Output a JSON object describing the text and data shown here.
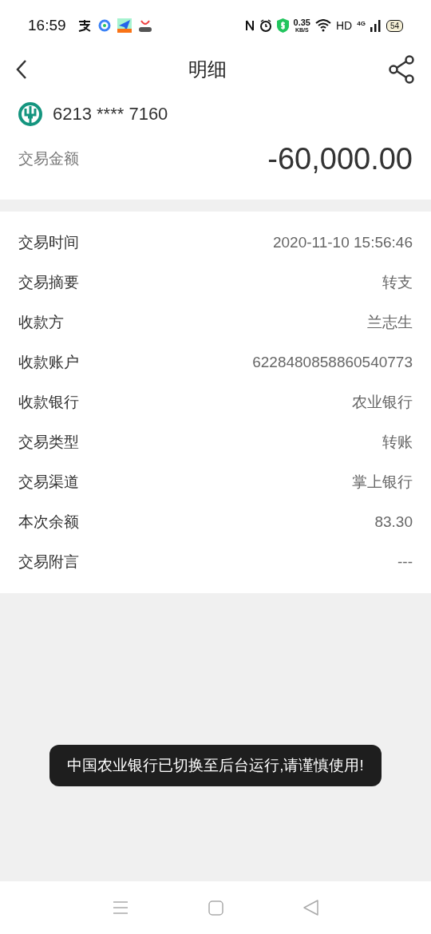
{
  "status_bar": {
    "time": "16:59",
    "speed": "0.35",
    "speed_unit": "KB/S",
    "network_label": "HD",
    "cell_label": "4G",
    "battery": "54"
  },
  "header": {
    "title": "明细"
  },
  "account": {
    "card_number": "6213 **** 7160",
    "amount_label": "交易金额",
    "amount": "-60,000.00"
  },
  "details": [
    {
      "label": "交易时间",
      "value": "2020-11-10 15:56:46"
    },
    {
      "label": "交易摘要",
      "value": "转支"
    },
    {
      "label": "收款方",
      "value": "兰志生"
    },
    {
      "label": "收款账户",
      "value": "6228480858860540773"
    },
    {
      "label": "收款银行",
      "value": "农业银行"
    },
    {
      "label": "交易类型",
      "value": "转账"
    },
    {
      "label": "交易渠道",
      "value": "掌上银行"
    },
    {
      "label": "本次余额",
      "value": "83.30"
    },
    {
      "label": "交易附言",
      "value": "---"
    }
  ],
  "toast": {
    "text": "中国农业银行已切换至后台运行,请谨慎使用!"
  }
}
